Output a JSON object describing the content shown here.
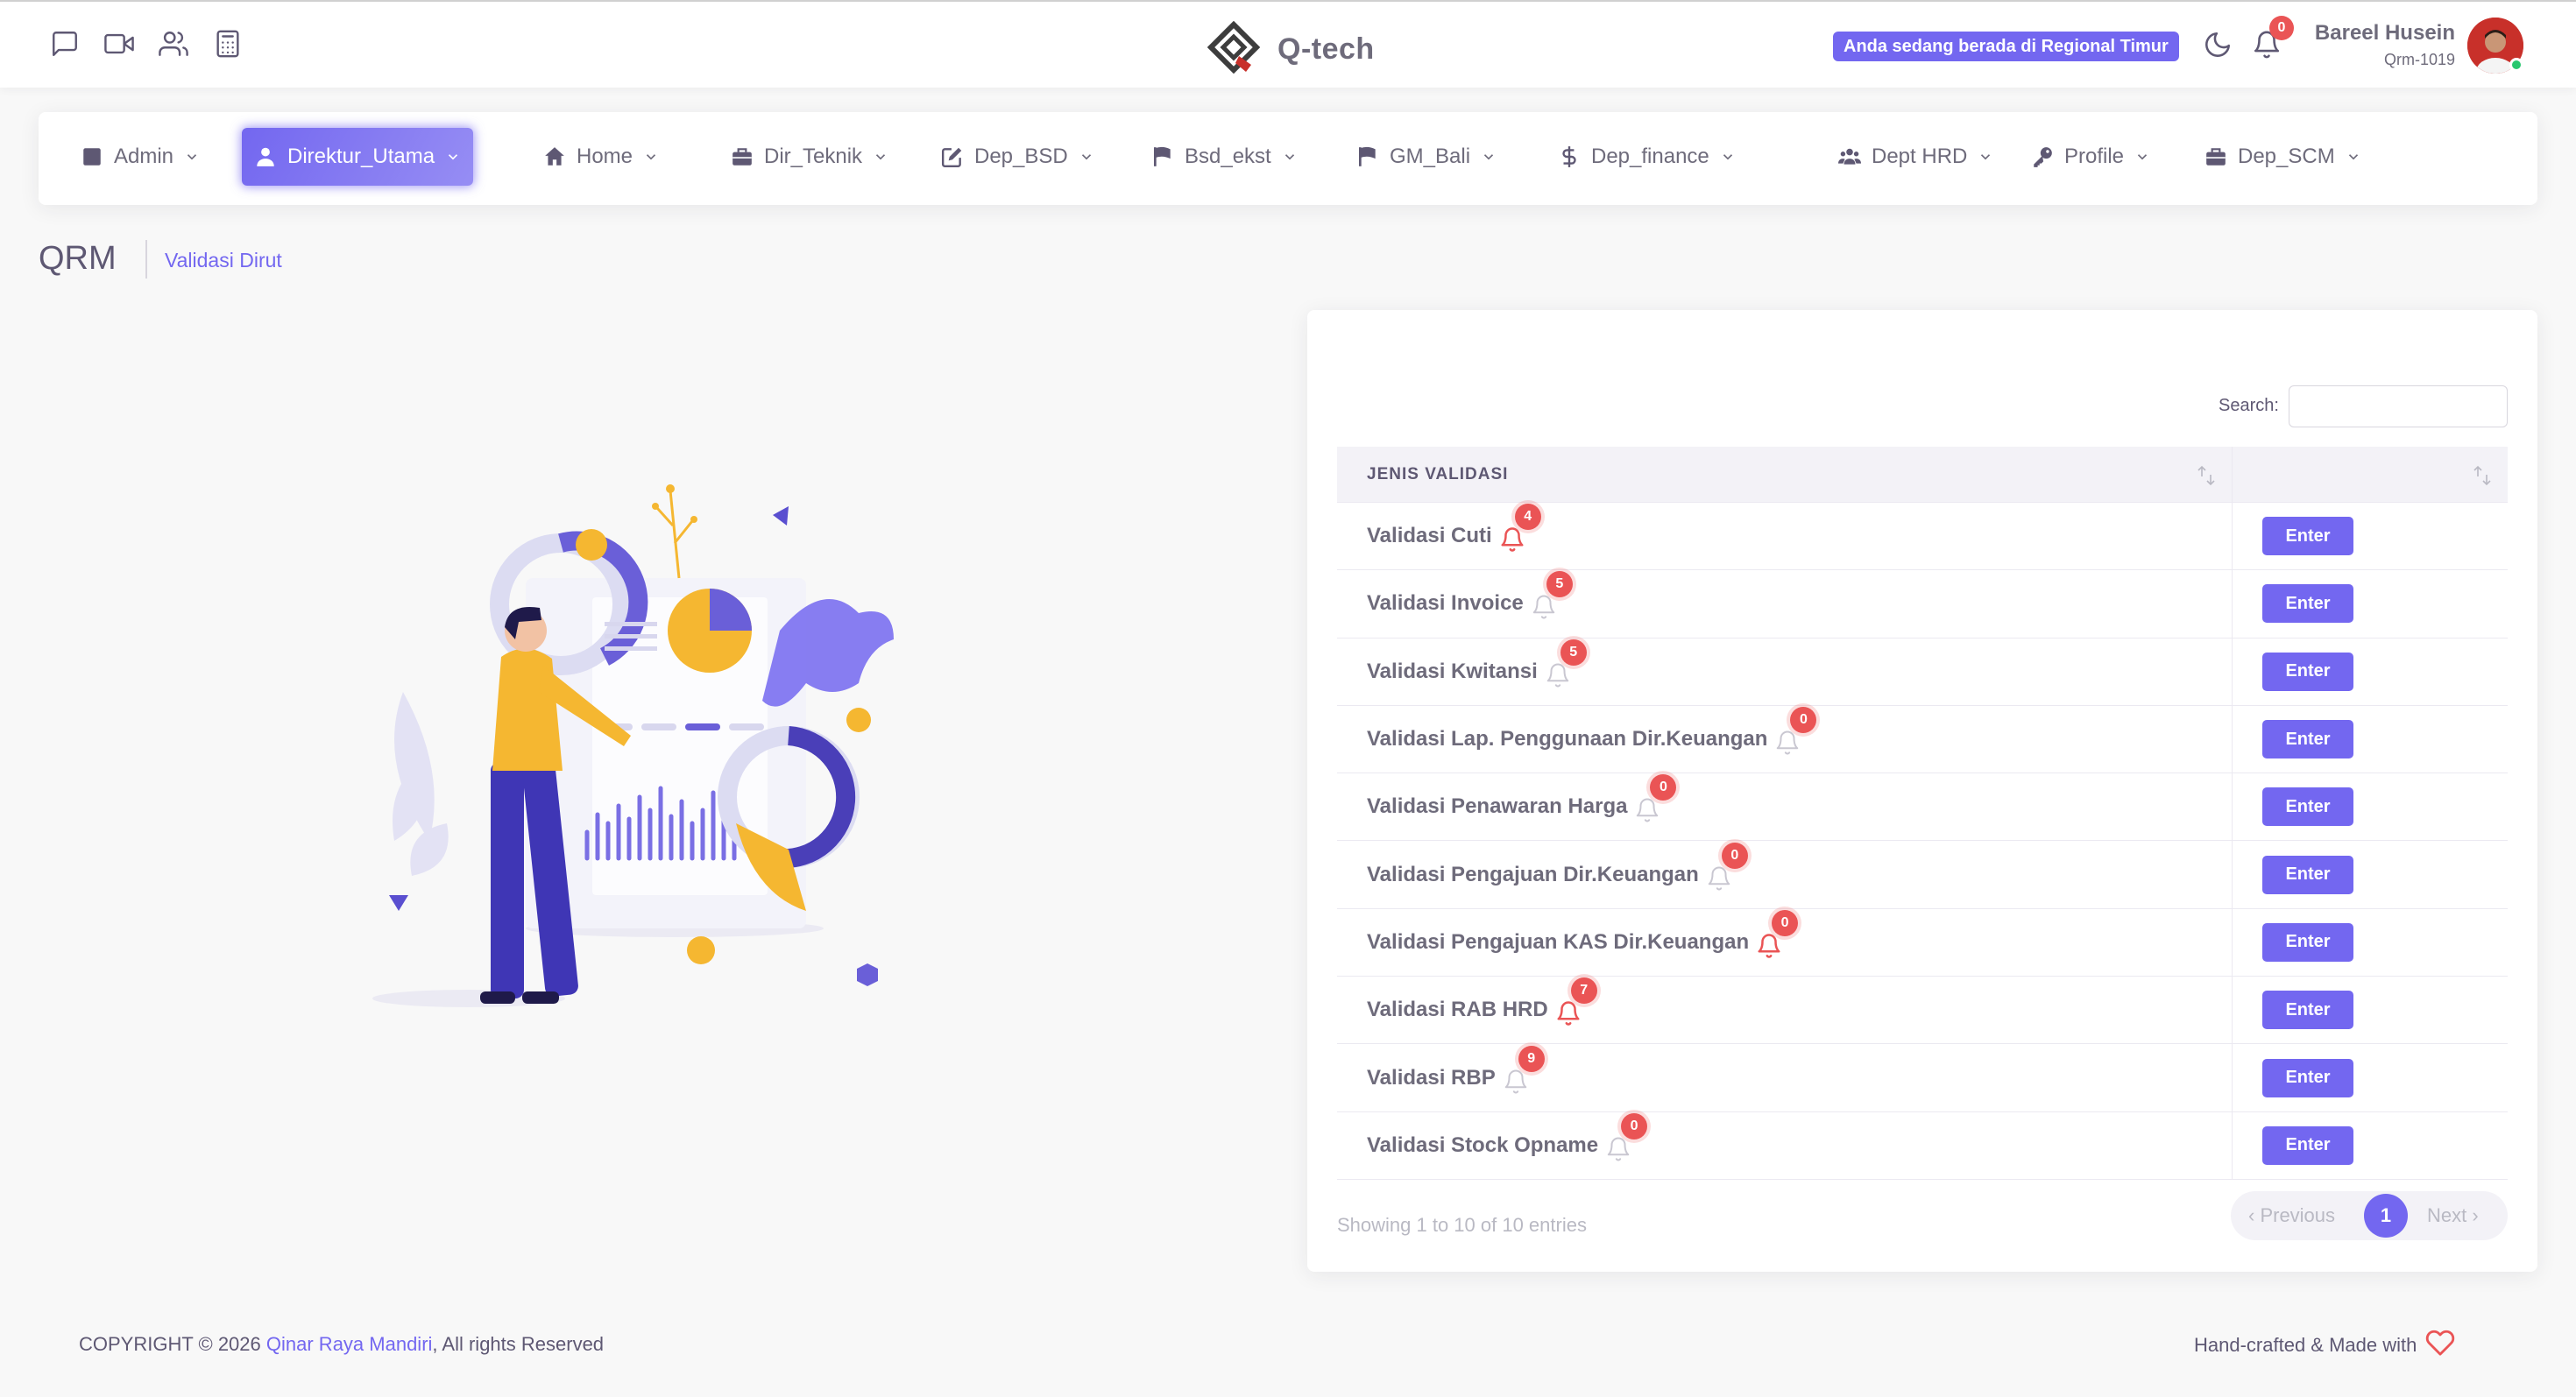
{
  "header": {
    "brand_name": "Q-tech",
    "region_badge": "Anda sedang berada di Regional Timur",
    "notification_count": "0",
    "user_name": "Bareel Husein",
    "user_id": "Qrm-1019",
    "icons": [
      "chat-icon",
      "video-icon",
      "users-icon",
      "calculator-icon",
      "moon-icon",
      "bell-icon"
    ]
  },
  "menu": {
    "items": [
      {
        "label": "Admin",
        "icon": "square-icon"
      },
      {
        "label": "Direktur_Utama",
        "icon": "user-icon",
        "active": true
      },
      {
        "label": "Home",
        "icon": "home-icon"
      },
      {
        "label": "Dir_Teknik",
        "icon": "briefcase-icon"
      },
      {
        "label": "Dep_BSD",
        "icon": "edit-icon"
      },
      {
        "label": "Bsd_ekst",
        "icon": "flag-icon"
      },
      {
        "label": "GM_Bali",
        "icon": "flag-icon"
      },
      {
        "label": "Dep_finance",
        "icon": "dollar-icon"
      },
      {
        "label": "Dept HRD",
        "icon": "users-icon"
      },
      {
        "label": "Profile",
        "icon": "key-icon"
      },
      {
        "label": "Dep_SCM",
        "icon": "briefcase-icon"
      }
    ]
  },
  "page": {
    "title": "QRM",
    "breadcrumb": "Validasi Dirut"
  },
  "table": {
    "search_label": "Search:",
    "search_value": "",
    "columns": [
      "JENIS VALIDASI",
      ""
    ],
    "rows": [
      {
        "label": "Validasi Cuti",
        "count": "4",
        "bell": "red",
        "action": "Enter"
      },
      {
        "label": "Validasi Invoice",
        "count": "5",
        "bell": "faint",
        "action": "Enter"
      },
      {
        "label": "Validasi Kwitansi",
        "count": "5",
        "bell": "faint",
        "action": "Enter"
      },
      {
        "label": "Validasi Lap. Penggunaan Dir.Keuangan",
        "count": "0",
        "bell": "faint",
        "action": "Enter"
      },
      {
        "label": "Validasi Penawaran Harga",
        "count": "0",
        "bell": "faint",
        "action": "Enter"
      },
      {
        "label": "Validasi Pengajuan Dir.Keuangan",
        "count": "0",
        "bell": "faint",
        "action": "Enter"
      },
      {
        "label": "Validasi Pengajuan KAS Dir.Keuangan",
        "count": "0",
        "bell": "red",
        "action": "Enter"
      },
      {
        "label": "Validasi RAB HRD",
        "count": "7",
        "bell": "red",
        "action": "Enter"
      },
      {
        "label": "Validasi RBP",
        "count": "9",
        "bell": "faint",
        "action": "Enter"
      },
      {
        "label": "Validasi Stock Opname",
        "count": "0",
        "bell": "faint",
        "action": "Enter"
      }
    ],
    "entries_info": "Showing 1 to 10 of 10 entries",
    "pagination": {
      "prev": "‹ Previous",
      "current": "1",
      "next": "Next ›"
    }
  },
  "footer": {
    "copyright_prefix": "COPYRIGHT © 2026 ",
    "company": "Qinar Raya Mandiri",
    "copyright_suffix": ", All rights Reserved",
    "made_with": "Hand-crafted & Made with"
  },
  "colors": {
    "primary": "#7367f0",
    "danger": "#ea5455",
    "text": "#5e5873",
    "background": "#f8f8f8"
  }
}
